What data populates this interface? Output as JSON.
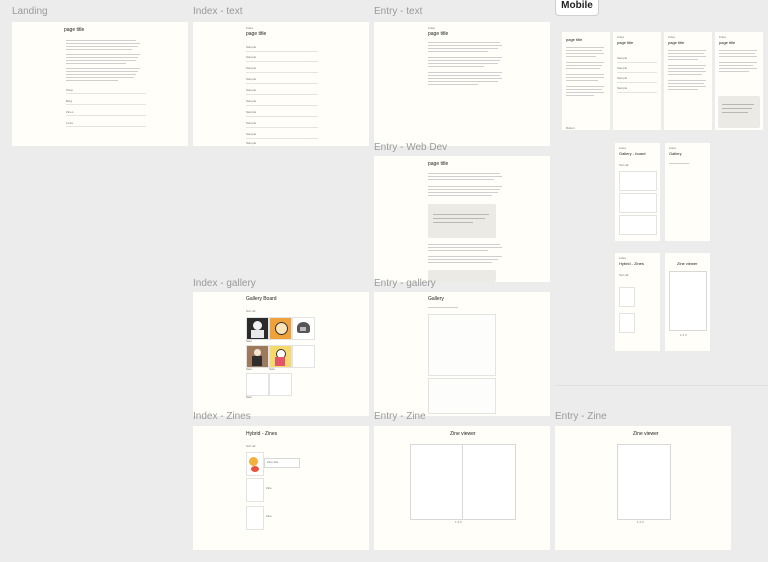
{
  "mobile_label": "Mobile",
  "frames": {
    "landing": {
      "label": "Landing",
      "title": "page title",
      "nav": [
        "Shop",
        "Blog",
        "Zines",
        "Links"
      ]
    },
    "index_text": {
      "label": "Index - text",
      "crumb": "index",
      "title": "page title",
      "items": [
        "Sample",
        "Sample",
        "Sample",
        "Sample",
        "Sample",
        "Sample",
        "Sample",
        "Sample",
        "Sample",
        "Sample"
      ]
    },
    "entry_text": {
      "label": "Entry - text",
      "crumb": "index",
      "title": "page title"
    },
    "entry_webdev": {
      "label": "Entry - Web Dev",
      "title": "page title"
    },
    "index_gallery": {
      "label": "Index - gallery",
      "title": "Gallery Board",
      "filter": "Sort all",
      "captions": [
        "Sam",
        "Sam",
        "Sam",
        "Sam"
      ]
    },
    "entry_gallery": {
      "label": "Entry - gallery",
      "title": "Gallery"
    },
    "index_zines": {
      "label": "Index - Zines",
      "title": "Hybrid - Zines",
      "filter": "Sort all",
      "items": [
        "Zine title",
        "Zine",
        "Zine"
      ]
    },
    "entry_zine": {
      "label": "Entry - Zine",
      "title": "Zine viewer",
      "pager": "1 2 3"
    },
    "entry_zine_2": {
      "label": "Entry - Zine",
      "title": "Zine viewer",
      "pager": "1 2 3"
    }
  },
  "mobile": {
    "m1": {
      "title": "page title",
      "foot": "Button"
    },
    "m2": {
      "crumb": "index",
      "title": "page title",
      "items": [
        "Sample",
        "Sample",
        "Sample",
        "Sample"
      ]
    },
    "m3": {
      "crumb": "index",
      "title": "page title"
    },
    "m4": {
      "crumb": "index",
      "title": "page title"
    },
    "m5": {
      "crumb": "index",
      "title": "Gallery - board",
      "filter": "Sort all"
    },
    "m6": {
      "crumb": "index",
      "title": "Gallery"
    },
    "m7": {
      "crumb": "index",
      "title": "Hybrid - Zines",
      "filter": "Sort all"
    },
    "m8": {
      "title": "Zine viewer",
      "pager": "1 2 3"
    }
  }
}
